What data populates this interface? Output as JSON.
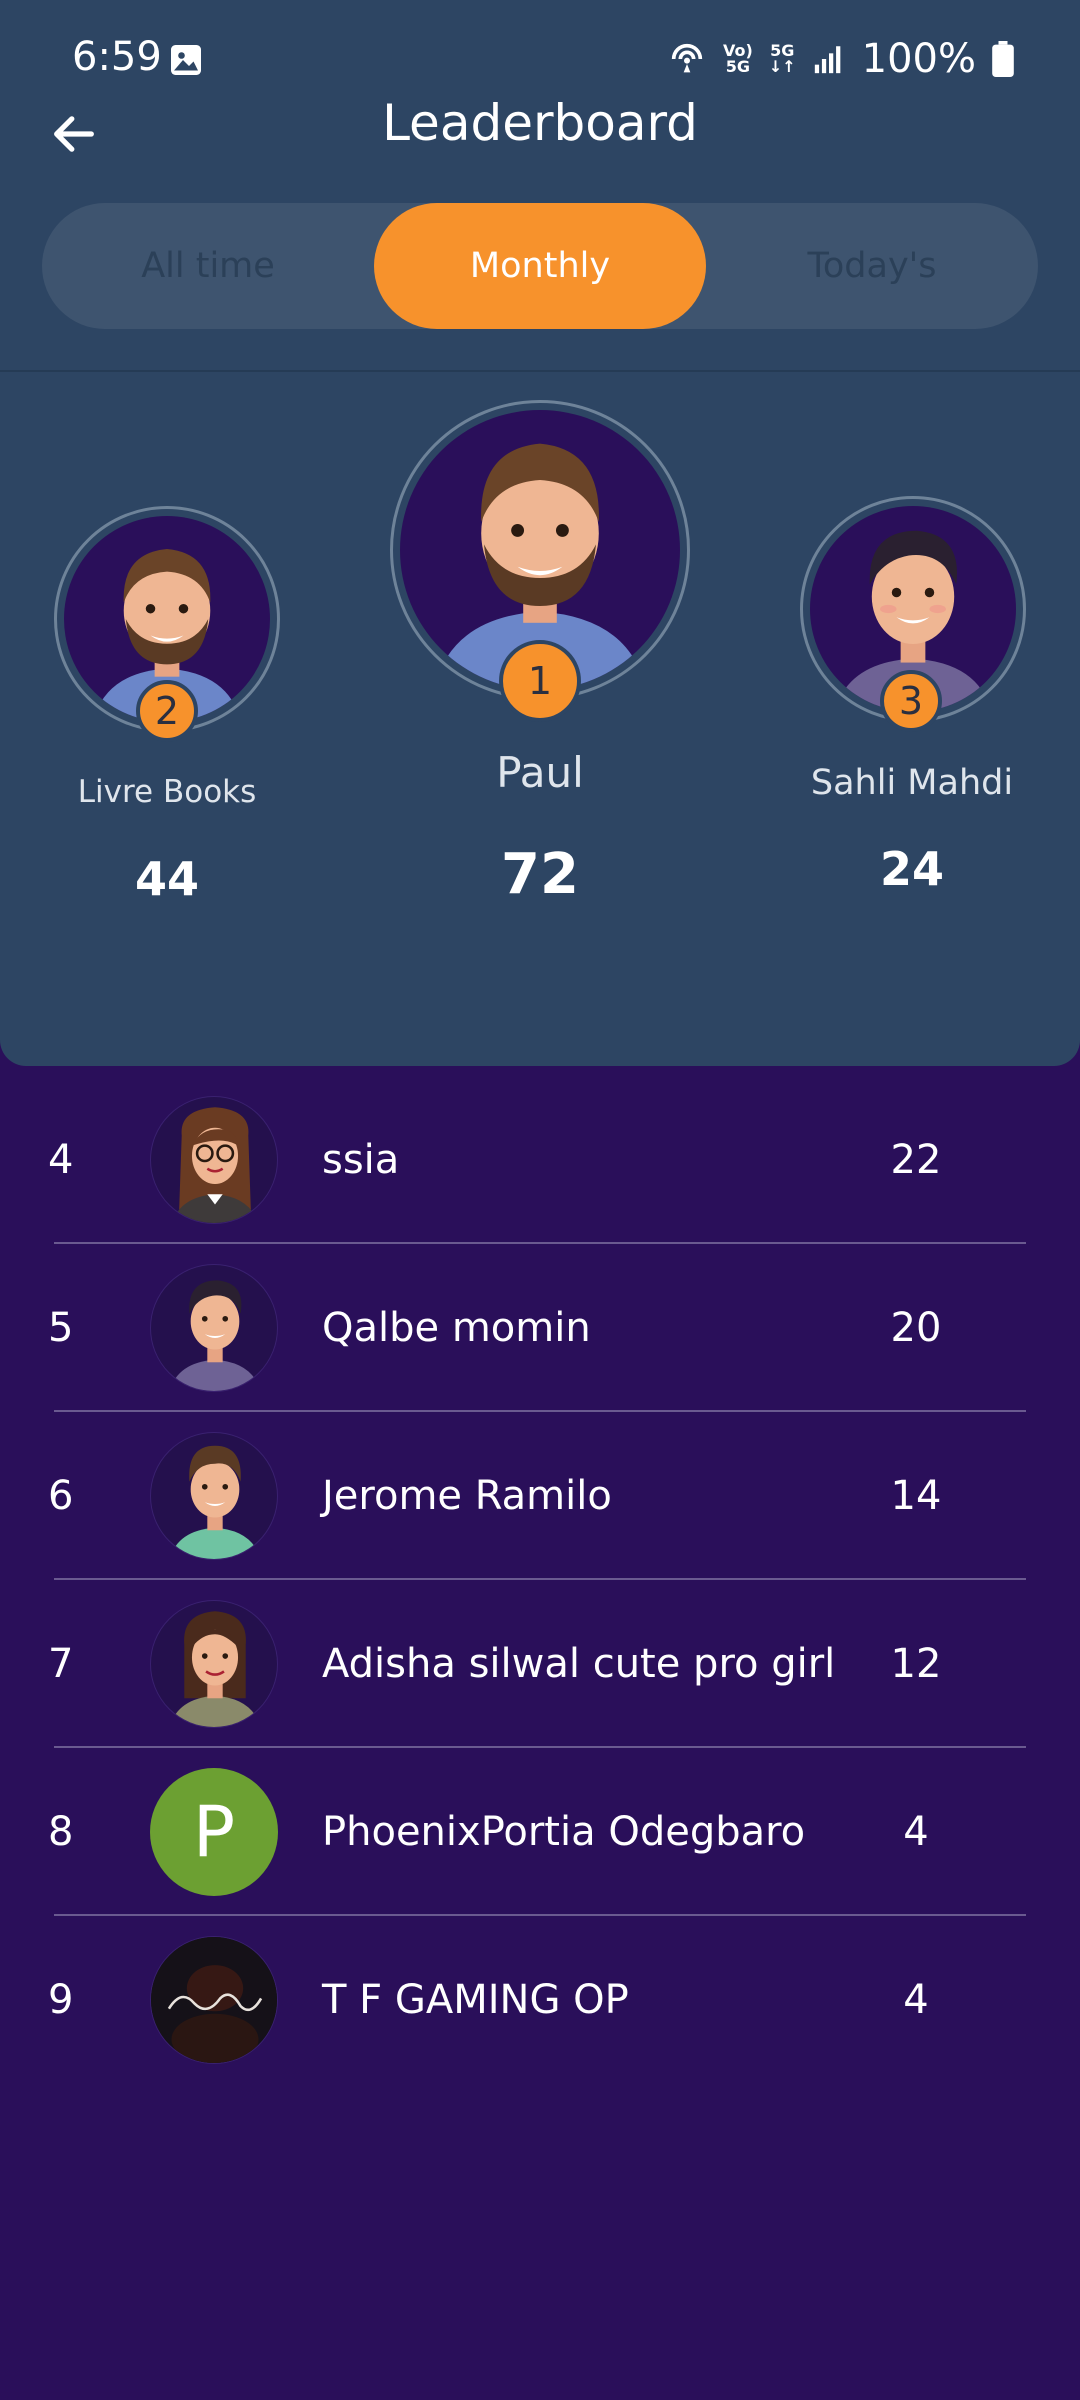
{
  "status_bar": {
    "time": "6:59",
    "battery": "100%",
    "net_top": "Vo)",
    "net_bottom": "5G",
    "net2_top": "5G",
    "net2_bottom": "↓↑"
  },
  "header": {
    "title": "Leaderboard"
  },
  "tabs": [
    {
      "label": "All time",
      "active": false
    },
    {
      "label": "Monthly",
      "active": true
    },
    {
      "label": "Today's",
      "active": false
    }
  ],
  "podium": {
    "first": {
      "rank": "1",
      "name": "Paul",
      "score": "72"
    },
    "second": {
      "rank": "2",
      "name": "Livre Books",
      "score": "44"
    },
    "third": {
      "rank": "3",
      "name": "Sahli Mahdi",
      "score": "24"
    }
  },
  "list": [
    {
      "rank": "4",
      "name": "ssia",
      "score": "22",
      "avatar": "avatar-woman-glasses"
    },
    {
      "rank": "5",
      "name": "Qalbe momin",
      "score": "20",
      "avatar": "avatar-man-purple-shirt"
    },
    {
      "rank": "6",
      "name": "Jerome Ramilo",
      "score": "14",
      "avatar": "avatar-man-green-shirt"
    },
    {
      "rank": "7",
      "name": "Adisha silwal cute pro girl",
      "score": "12",
      "avatar": "avatar-woman"
    },
    {
      "rank": "8",
      "name": "PhoenixPortia Odegbaro",
      "score": "4",
      "avatar": "letter-avatar",
      "letter": "P"
    },
    {
      "rank": "9",
      "name": "T F GAMING OP",
      "score": "4",
      "avatar": "photo-avatar"
    }
  ],
  "colors": {
    "accent": "#f7922c",
    "panel": "#2d4563",
    "background": "#2a0f5a"
  }
}
